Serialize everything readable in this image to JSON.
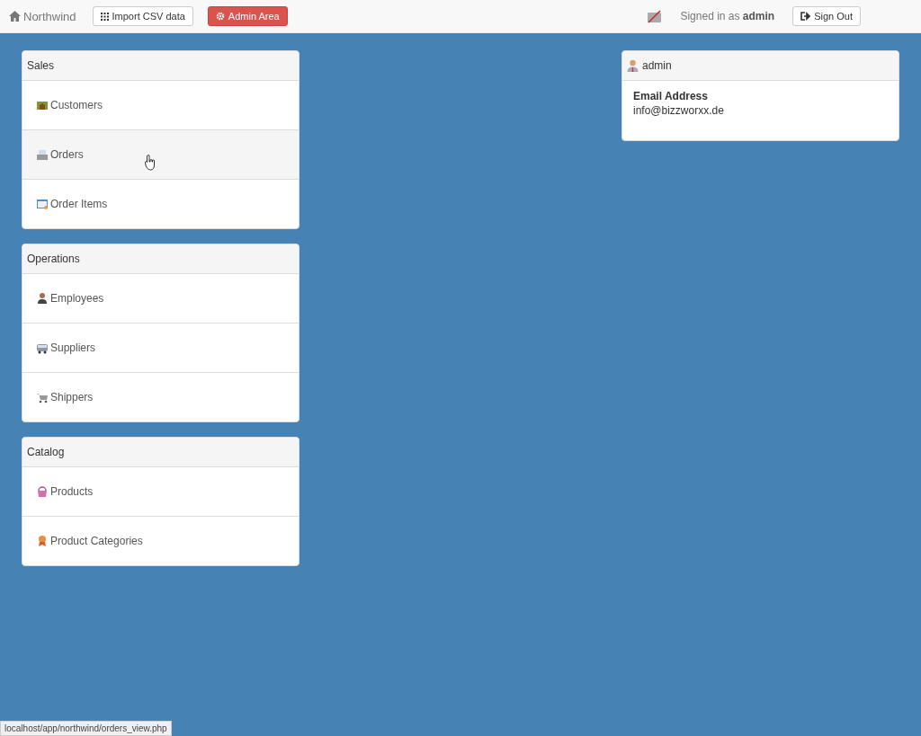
{
  "navbar": {
    "brand": "Northwind",
    "import_button": "Import CSV data",
    "admin_button": "Admin Area",
    "signed_in_prefix": "Signed in as",
    "signed_in_user": "admin",
    "sign_out_button": "Sign Out"
  },
  "groups": [
    {
      "title": "Sales",
      "items": [
        {
          "label": "Customers",
          "hovered": false
        },
        {
          "label": "Orders",
          "hovered": true
        },
        {
          "label": "Order Items",
          "hovered": false
        }
      ]
    },
    {
      "title": "Operations",
      "items": [
        {
          "label": "Employees",
          "hovered": false
        },
        {
          "label": "Suppliers",
          "hovered": false
        },
        {
          "label": "Shippers",
          "hovered": false
        }
      ]
    },
    {
      "title": "Catalog",
      "items": [
        {
          "label": "Products",
          "hovered": false
        },
        {
          "label": "Product Categories",
          "hovered": false
        }
      ]
    }
  ],
  "profile": {
    "title": "admin",
    "field_label": "Email Address",
    "field_value": "info@bizzworxx.de"
  },
  "status_bar": "localhost/app/northwind/orders_view.php"
}
